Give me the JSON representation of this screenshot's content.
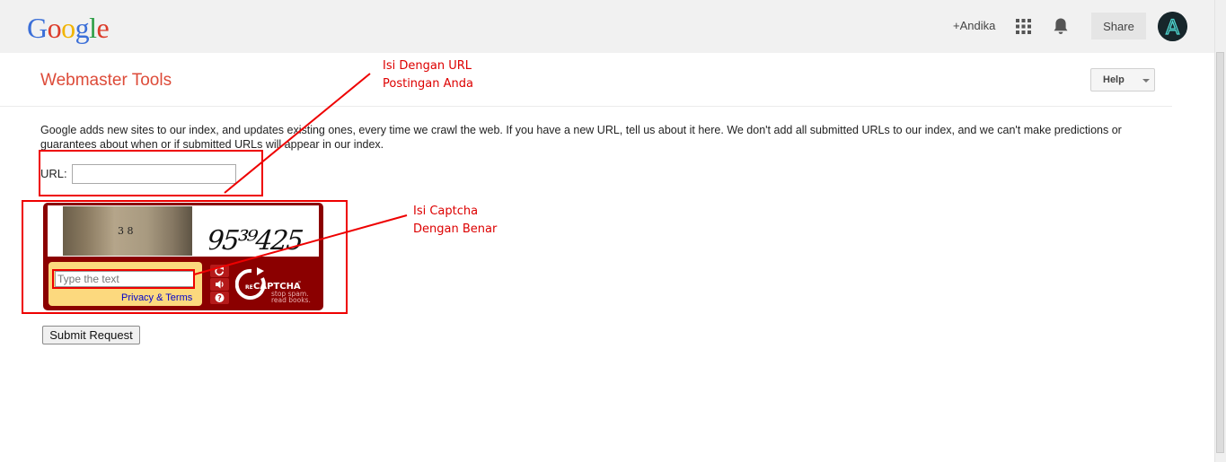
{
  "header": {
    "logo_letters": [
      {
        "ch": "G",
        "color": "#3b6fd8"
      },
      {
        "ch": "o",
        "color": "#dc3c2a"
      },
      {
        "ch": "o",
        "color": "#f1b400"
      },
      {
        "ch": "g",
        "color": "#3b6fd8"
      },
      {
        "ch": "l",
        "color": "#2d9e46"
      },
      {
        "ch": "e",
        "color": "#dc3c2a"
      }
    ],
    "user_name": "+Andika",
    "share_label": "Share",
    "avatar_letter": "A",
    "apps_icon": "apps-grid-icon",
    "notifications_icon": "bell-icon"
  },
  "page": {
    "title": "Webmaster Tools",
    "help_label": "Help",
    "intro_text": "Google adds new sites to our index, and updates existing ones, every time we crawl the web. If you have a new URL, tell us about it here. We don't add all submitted URLs to our index, and we can't make predictions or guarantees about when or if submitted URLs will appear in our index.",
    "url_label": "URL:",
    "url_value": "",
    "submit_label": "Submit Request"
  },
  "captcha": {
    "photo_number": "3 8",
    "challenge_text": "95³⁹425",
    "input_placeholder": "Type the text",
    "privacy_terms": "Privacy & Terms",
    "brand_prefix": "RE",
    "brand_name": "CAPTCHA",
    "brand_tm": "™",
    "tagline_1": "stop spam.",
    "tagline_2": "read books."
  },
  "annotations": {
    "url_note_1": "Isi Dengan URL",
    "url_note_2": "Postingan Anda",
    "captcha_note_1": "Isi Captcha",
    "captcha_note_2": "Dengan Benar",
    "color": "#e00000"
  }
}
